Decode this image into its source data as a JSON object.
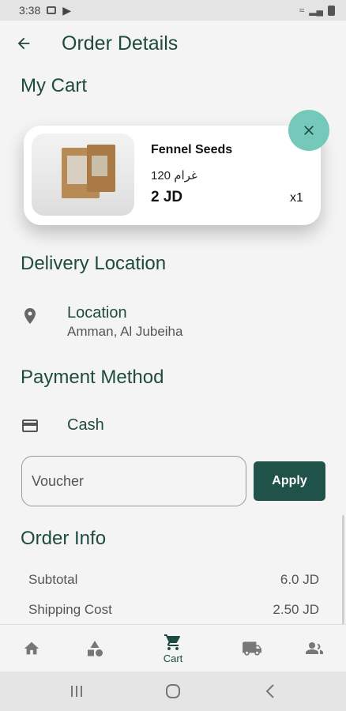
{
  "status_bar": {
    "time": "3:38"
  },
  "header": {
    "title": "Order Details"
  },
  "cart": {
    "section_title": "My Cart",
    "item": {
      "name": "Fennel Seeds",
      "weight": "120 غرام",
      "price": "2 JD",
      "quantity": "x1"
    }
  },
  "delivery": {
    "section_title": "Delivery Location",
    "label": "Location",
    "address": "Amman, Al Jubeiha"
  },
  "payment": {
    "section_title": "Payment Method",
    "method": "Cash"
  },
  "voucher": {
    "placeholder": "Voucher",
    "apply_label": "Apply"
  },
  "order_info": {
    "section_title": "Order Info",
    "rows": [
      {
        "label": "Subtotal",
        "value": "6.0 JD"
      },
      {
        "label": "Shipping Cost",
        "value": "2.50 JD"
      }
    ]
  },
  "bottom_nav": {
    "items": [
      {
        "icon": "home-icon",
        "label": ""
      },
      {
        "icon": "categories-icon",
        "label": ""
      },
      {
        "icon": "cart-icon",
        "label": "Cart"
      },
      {
        "icon": "truck-icon",
        "label": ""
      },
      {
        "icon": "people-icon",
        "label": ""
      }
    ]
  },
  "colors": {
    "primary": "#1f4a3f",
    "accent": "#74c9ba",
    "button": "#1f5248",
    "background": "#f3f4f3"
  }
}
